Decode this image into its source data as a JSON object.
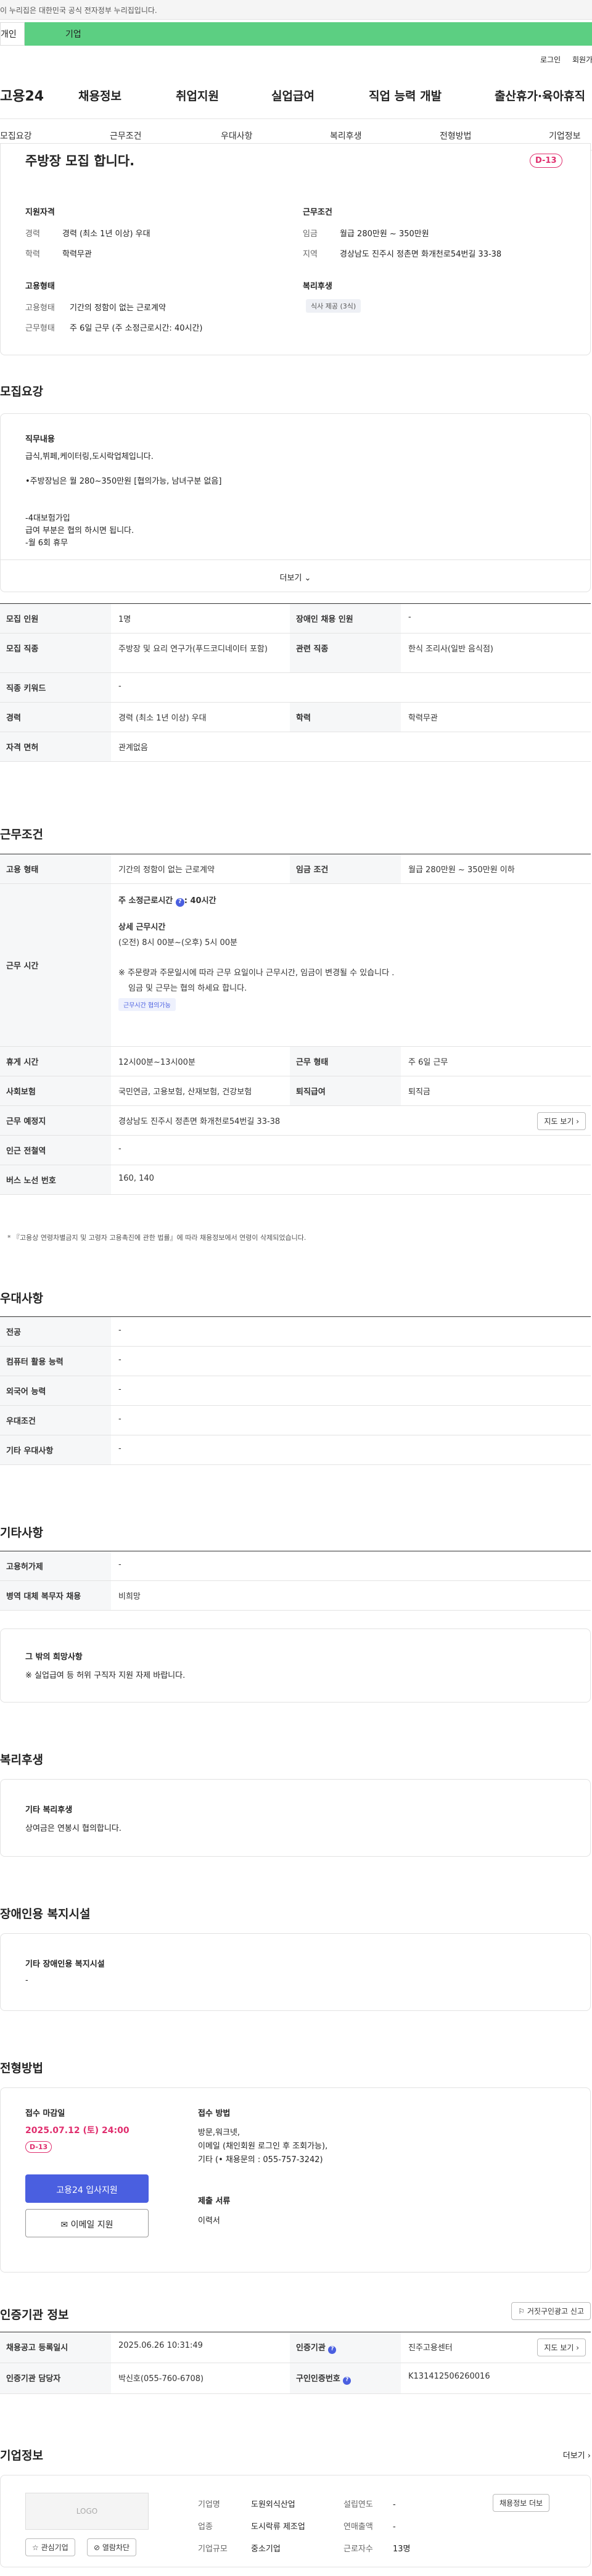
{
  "gov_banner": "이 누리집은 대한민국 공식 전자정부 누리집입니다.",
  "user_tabs": [
    "개인",
    "기업"
  ],
  "util": {
    "login": "로그인",
    "signup": "회원가입"
  },
  "logo": "고용24",
  "gnb": [
    "채용정보",
    "취업지원",
    "실업급여",
    "직업 능력 개발",
    "출산휴가·육아휴직"
  ],
  "subnav": [
    "모집요강",
    "근무조건",
    "우대사항",
    "복리후생",
    "전형방법",
    "기업정보"
  ],
  "summary": {
    "title": "주방장 모집 합니다.",
    "dday": "D-13",
    "qual_title": "지원자격",
    "qual": [
      [
        "경력",
        "경력 (최소 1년 이상) 우대"
      ],
      [
        "학력",
        "학력무관"
      ]
    ],
    "cond_title": "근무조건",
    "cond": [
      [
        "임금",
        "월급 280만원 ~ 350만원"
      ],
      [
        "지역",
        "경상남도 진주시 정촌면 화개천로54번길 33-38"
      ]
    ],
    "emp_title": "고용형태",
    "emp": [
      [
        "고용형태",
        "기간의 정함이 없는 근로계약"
      ],
      [
        "근무형태",
        "주 6일 근무 (주 소정근로시간: 40시간)"
      ]
    ],
    "welfare_title": "복리후생",
    "welfare_chip": "식사 제공 (3식)"
  },
  "recruit": {
    "title": "모집요강",
    "box_title": "직무내용",
    "lines": [
      "급식,뷔페,케이터링,도시락업체입니다.",
      "",
      "•주방장님은 월 280~350만원 [협의가능, 남녀구분 없음]",
      "",
      "",
      "-4대보험가입",
      "급여 부분은 협의 하시면 됩니다.",
      "-월 6회 휴무"
    ],
    "more": "더보기",
    "rows": [
      [
        "모집 인원",
        "1명",
        "장애인 채용 인원",
        "-"
      ],
      [
        "모집 직종",
        "주방장 및 요리 연구가(푸드코디네이터 포함)",
        "관련 직종",
        "한식 조리사(일반 음식점)"
      ],
      [
        "직종 키워드",
        "-"
      ],
      [
        "경력",
        "경력 (최소 1년 이상) 우대",
        "학력",
        "학력무관"
      ],
      [
        "자격 면허",
        "관계없음"
      ]
    ]
  },
  "cond": {
    "title": "근무조건",
    "r1": [
      "고용 형태",
      "기간의 정함이 없는 근로계약",
      "임금 조건",
      "월급 280만원 ~ 350만원 이하"
    ],
    "worktime_label": "근무 시간",
    "weekly": "주 소정근로시간",
    "weekly_val": "40시간",
    "detail_title": "상세 근무시간",
    "detail": "(오전) 8시 00분~(오후) 5시 00분",
    "note1": "※ 주문량과 주문일시에 따라 근무 요일이나 근무시간, 임금이 변경될 수 있습니다 .",
    "note2": "임금 및 근무는 협의 하세요 합니다.",
    "chip": "근무시간 협의가능",
    "rows": [
      [
        "휴게 시간",
        "12시00분~13시00분",
        "근무 형태",
        "주 6일 근무"
      ],
      [
        "사회보험",
        "국민연금, 고용보험, 산재보험, 건강보험",
        "퇴직급여",
        "퇴직금"
      ]
    ],
    "place": [
      "근무 예정지",
      "경상남도 진주시 정촌면 화개천로54번길 33-38"
    ],
    "map": "지도 보기",
    "rows2": [
      [
        "인근 전철역",
        "-"
      ],
      [
        "버스 노선 번호",
        "160, 140"
      ]
    ],
    "footnote": "* 『고용상 연령차별금지 및 고령자 고용촉진에 관한 법률』에 따라 채용정보에서 연령이 삭제되었습니다."
  },
  "pref": {
    "title": "우대사항",
    "rows": [
      [
        "전공",
        "-"
      ],
      [
        "컴퓨터 활용 능력",
        "-"
      ],
      [
        "외국어 능력",
        "-"
      ],
      [
        "우대조건",
        "-"
      ],
      [
        "기타 우대사항",
        "-"
      ]
    ]
  },
  "etc": {
    "title": "기타사항",
    "rows": [
      [
        "고용허가제",
        "-"
      ],
      [
        "병역 대체 복무자 채용",
        "비희망"
      ]
    ],
    "box_title": "그 밖의 희망사항",
    "box_text": "※ 실업급여 등 허위 구직자 지원 자제 바랍니다."
  },
  "welf": {
    "title": "복리후생",
    "box_title": "기타 복리후생",
    "box_text": "상여금은 연봉시 협의합니다."
  },
  "dis": {
    "title": "장애인용 복지시설",
    "box_title": "기타 장애인용 복지시설",
    "box_text": "-"
  },
  "sel": {
    "title": "전형방법",
    "deadline_label": "접수 마감일",
    "deadline": "2025.07.12 (토) 24:00",
    "dday": "D-13",
    "apply": "고용24 입사지원",
    "email": "이메일 지원",
    "method_title": "접수 방법",
    "method": [
      "방문,워크넷,",
      "이메일 (채인회원 로그인 후 조회가능),",
      "기타 (• 채용문의 : 055-757-3242)"
    ],
    "docs_title": "제출 서류",
    "docs": "이력서"
  },
  "cert": {
    "title": "인증기관 정보",
    "report": "거짓구인광고 신고",
    "r1": [
      "채용공고 등록일시",
      "2025.06.26 10:31:49",
      "인증기관",
      "진주고용센터"
    ],
    "map": "지도 보기",
    "r2": [
      "인증기관 담당자",
      "박신호(055-760-6708)",
      "구인인증번호",
      "K131412506260016"
    ]
  },
  "company": {
    "title": "기업정보",
    "more": "더보기",
    "logo": "LOGO",
    "fav": "관심기업",
    "block": "열람차단",
    "info": [
      [
        "기업명",
        "도원외식산업",
        "설립연도",
        "-"
      ],
      [
        "업종",
        "도시락류 제조업",
        "연매출액",
        "-"
      ],
      [
        "기업규모",
        "중소기업",
        "근로자수",
        "13명"
      ]
    ],
    "jobs_btn": "채용정보 더보"
  },
  "colors": {
    "accent": "#4a5fe0",
    "dday": "#e02e6e",
    "tab_green": "#5ccf82"
  }
}
